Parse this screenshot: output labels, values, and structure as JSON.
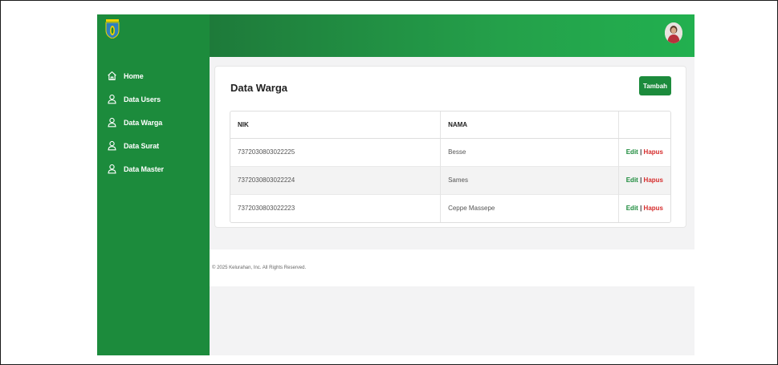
{
  "sidebar": {
    "items": [
      {
        "label": "Home",
        "icon": "home-icon"
      },
      {
        "label": "Data Users",
        "icon": "user-icon"
      },
      {
        "label": "Data Warga",
        "icon": "user-icon"
      },
      {
        "label": "Data Surat",
        "icon": "user-icon"
      },
      {
        "label": "Data Master",
        "icon": "user-icon"
      }
    ]
  },
  "page": {
    "title": "Data Warga",
    "add_label": "Tambah"
  },
  "table": {
    "headers": [
      "NIK",
      "NAMA",
      ""
    ],
    "rows": [
      {
        "nik": "7372030803022225",
        "nama": "Besse"
      },
      {
        "nik": "7372030803022224",
        "nama": "Sames"
      },
      {
        "nik": "7372030803022223",
        "nama": "Ceppe Massepe"
      }
    ],
    "edit_label": "Edit",
    "separator": "|",
    "delete_label": "Hapus"
  },
  "footer": {
    "text": "© 2025 Kelurahan, Inc. All Rights Reserved."
  },
  "colors": {
    "primary": "#1c8b3c",
    "danger": "#d62d2d",
    "background": "#f3f3f4"
  }
}
